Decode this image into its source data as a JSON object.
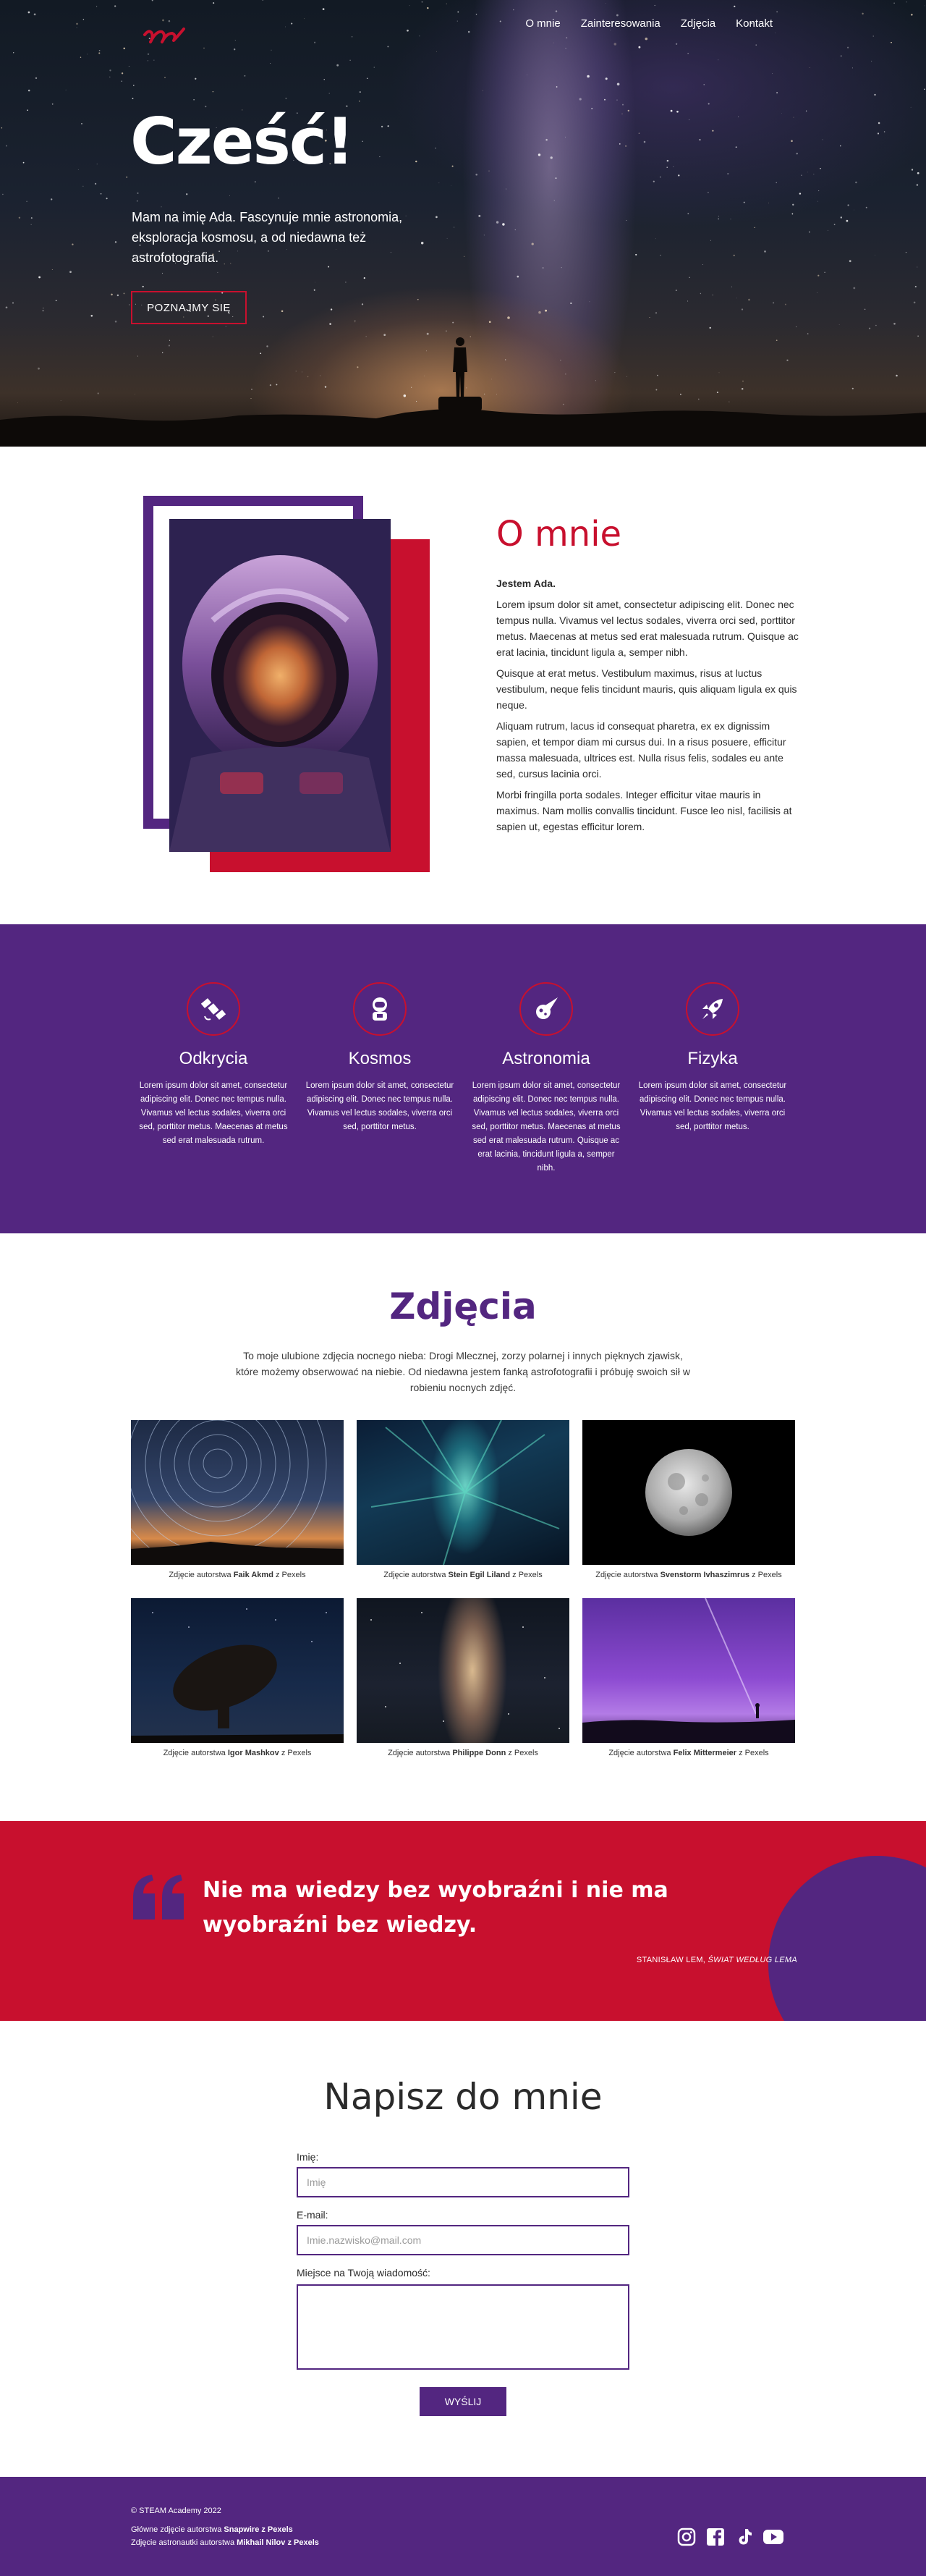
{
  "nav": {
    "logo_icon": "script-n-logo",
    "items": [
      "O mnie",
      "Zainteresowania",
      "Zdjęcia",
      "Kontakt"
    ]
  },
  "hero": {
    "title": "Cześć!",
    "text": "Mam na imię Ada. Fascynuje mnie astronomia, eksploracja kosmosu, a od niedawna też astrofotografia.",
    "button": "Poznajmy się"
  },
  "about": {
    "title": "O mnie",
    "lead": "Jestem Ada.",
    "paragraphs": [
      "Lorem ipsum dolor sit amet, consectetur adipiscing elit. Donec nec tempus nulla. Vivamus vel lectus sodales, viverra orci sed, porttitor metus. Maecenas at metus sed erat malesuada rutrum. Quisque ac erat lacinia, tincidunt ligula a, semper nibh.",
      "Quisque at erat metus. Vestibulum maximus, risus at luctus vestibulum, neque felis tincidunt mauris, quis aliquam ligula ex quis neque.",
      "Aliquam rutrum, lacus id consequat pharetra, ex ex dignissim sapien, et tempor diam mi cursus dui. In a risus posuere, efficitur massa malesuada, ultrices est. Nulla risus felis, sodales eu ante sed, cursus lacinia orci.",
      "Morbi fringilla porta sodales. Integer efficitur vitae mauris in maximus. Nam mollis convallis tincidunt. Fusce leo nisl, facilisis at sapien ut, egestas efficitur lorem."
    ]
  },
  "interests": [
    {
      "icon": "satellite-icon",
      "title": "Odkrycia",
      "text": "Lorem ipsum dolor sit amet, consectetur adipiscing elit. Donec nec tempus nulla. Vivamus vel lectus sodales, viverra orci sed, porttitor metus. Maecenas at metus sed erat malesuada rutrum."
    },
    {
      "icon": "astronaut-icon",
      "title": "Kosmos",
      "text": "Lorem ipsum dolor sit amet, consectetur adipiscing elit. Donec nec tempus nulla. Vivamus vel lectus sodales, viverra orci sed, porttitor metus."
    },
    {
      "icon": "meteor-icon",
      "title": "Astronomia",
      "text": "Lorem ipsum dolor sit amet, consectetur adipiscing elit. Donec nec tempus nulla. Vivamus vel lectus sodales, viverra orci sed, porttitor metus. Maecenas at metus sed erat malesuada rutrum. Quisque ac erat lacinia, tincidunt ligula a, semper nibh."
    },
    {
      "icon": "rocket-icon",
      "title": "Fizyka",
      "text": "Lorem ipsum dolor sit amet, consectetur adipiscing elit. Donec nec tempus nulla. Vivamus vel lectus sodales, viverra orci sed, porttitor metus."
    }
  ],
  "gallery": {
    "title": "Zdjęcia",
    "intro": "To moje ulubione zdjęcia nocnego nieba: Drogi Mlecznej, zorzy polarnej i innych pięknych zjawisk, które możemy obserwować na niebie. Od niedawna jestem fanką astrofotografii i próbuję swoich sił w robieniu nocnych zdjęć.",
    "caption_prefix": "Zdjęcie autorstwa",
    "caption_source": "z Pexels",
    "photos": [
      {
        "author": "Faik Akmd",
        "alt": "star-trails-photo"
      },
      {
        "author": "Stein Egil Liland",
        "alt": "aurora-photo"
      },
      {
        "author": "Svenstorm Ivhaszimrus",
        "alt": "moon-photo"
      },
      {
        "author": "Igor Mashkov",
        "alt": "radio-telescope-photo"
      },
      {
        "author": "Philippe Donn",
        "alt": "milky-way-photo"
      },
      {
        "author": "Felix Mittermeier",
        "alt": "purple-night-sky-photo"
      }
    ]
  },
  "quote": {
    "text": "Nie ma wiedzy bez wyobraźni i nie ma wyobraźni bez wiedzy.",
    "author": "Stanisław Lem,",
    "source": "Świat według Lema"
  },
  "contact": {
    "title": "Napisz do mnie",
    "name_label": "Imię:",
    "name_placeholder": "Imię",
    "email_label": "E-mail:",
    "email_placeholder": "Imie.nazwisko@mail.com",
    "message_label": "Miejsce na Twoją wiadomość:",
    "send": "Wyślij"
  },
  "footer": {
    "copyright": "© STEAM Academy 2022",
    "credit1_prefix": "Główne zdjęcie autorstwa",
    "credit1_author": "Snapwire",
    "credit1_source": "z Pexels",
    "credit2_prefix": "Zdjęcie astronautki autorstwa",
    "credit2_author": "Mikhail Nilov",
    "credit2_source": "z Pexels",
    "socials": [
      "instagram-icon",
      "facebook-icon",
      "tiktok-icon",
      "youtube-icon"
    ]
  },
  "colors": {
    "accent_red": "#c8102e",
    "accent_purple": "#532680"
  }
}
